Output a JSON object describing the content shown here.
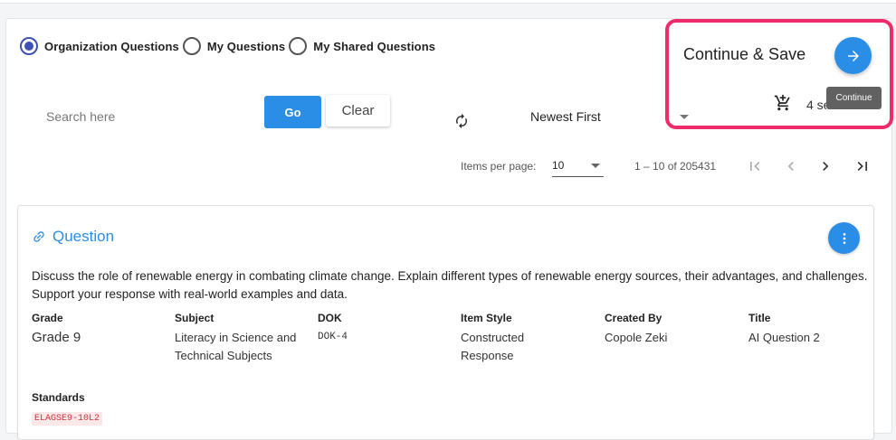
{
  "filters": {
    "scope_options": [
      {
        "label": "Organization Questions",
        "selected": true
      },
      {
        "label": "My Questions",
        "selected": false
      },
      {
        "label": "My Shared Questions",
        "selected": false
      }
    ]
  },
  "search": {
    "placeholder": "Search here",
    "value": "",
    "go_label": "Go",
    "clear_label": "Clear"
  },
  "sort": {
    "selected": "Newest First"
  },
  "actions": {
    "continue_label": "Continue & Save",
    "tooltip": "Continue",
    "selected_count_text": "4 selected",
    "highlight_color": "#ef2c6a"
  },
  "pager": {
    "items_per_page_label": "Items per page:",
    "items_per_page": "10",
    "range_text": "1 – 10 of 205431"
  },
  "question_card": {
    "title": "Question",
    "text": "Discuss the role of renewable energy in combating climate change. Explain different types of renewable energy sources, their advantages, and challenges. Support your response with real-world examples and data.",
    "fields": [
      {
        "label": "Grade",
        "value": "Grade 9"
      },
      {
        "label": "Subject",
        "value": "Literacy in Science and Technical Subjects"
      },
      {
        "label": "DOK",
        "value": "DOK-4"
      },
      {
        "label": "Item Style",
        "value": "Constructed Response"
      },
      {
        "label": "Created By",
        "value": "Copole Zeki"
      },
      {
        "label": "Title",
        "value": "AI Question 2"
      }
    ],
    "standards_label": "Standards",
    "standards": [
      "ELAGSE9-10L2"
    ]
  },
  "colors": {
    "primary": "#2a8de6",
    "radio_selected": "#3f51b5"
  }
}
